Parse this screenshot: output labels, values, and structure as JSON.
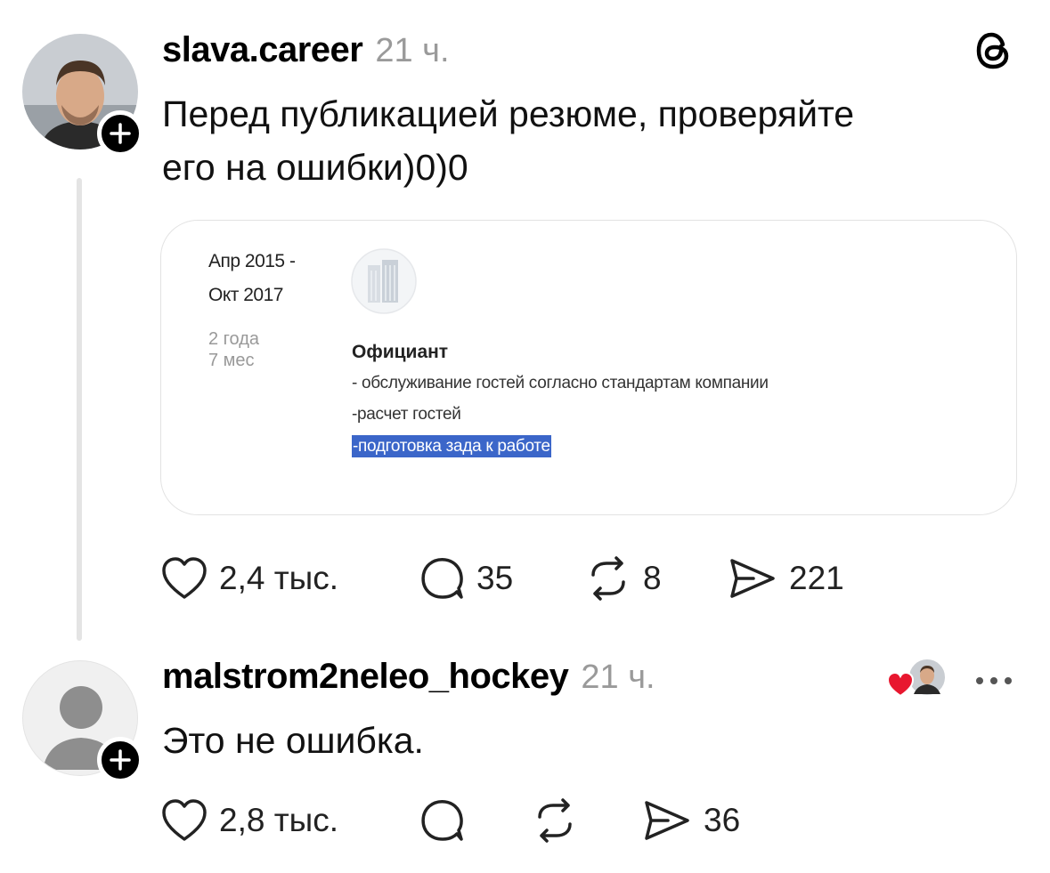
{
  "post": {
    "username": "slava.career",
    "time": "21 ч.",
    "text_line1": "Перед публикацией  резюме, проверяйте",
    "text_line2": "его на ошибки)0)0",
    "resume": {
      "date_from": "Апр 2015 -",
      "date_to": "Окт 2017",
      "duration_years": "2 года",
      "duration_months": "7 мес",
      "job_title": "Официант",
      "duty1": "- обслуживание гостей согласно стандартам компании",
      "duty2": "-расчет гостей",
      "duty3": "-подготовка зада к работе"
    },
    "likes": "2,4 тыс.",
    "comments": "35",
    "reposts": "8",
    "shares": "221"
  },
  "reply": {
    "username": "malstrom2neleo_hockey",
    "time": "21 ч.",
    "text": "Это не ошибка.",
    "likes": "2,8 тыс.",
    "shares": "36"
  },
  "icons": {
    "app_logo": "threads-logo-icon",
    "like": "heart-icon",
    "comment": "comment-bubble-icon",
    "repost": "repost-icon",
    "share": "send-icon",
    "follow": "plus-icon",
    "more": "more-icon"
  },
  "colors": {
    "highlight": "#3b66c9",
    "liked_heart": "#e8172f",
    "muted": "#9a9a9a"
  }
}
